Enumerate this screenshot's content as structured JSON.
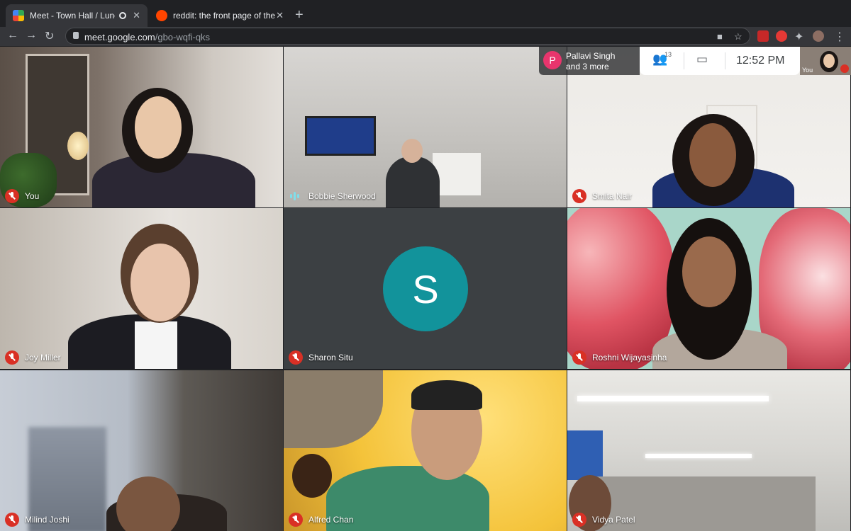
{
  "browser": {
    "tabs": [
      {
        "title": "Meet - Town Hall / Lunch &",
        "active": true
      },
      {
        "title": "reddit: the front page of the int",
        "active": false
      }
    ],
    "url_host": "meet.google.com",
    "url_path": "/gbo-wqfi-qks"
  },
  "meet": {
    "presenting": {
      "avatar_letter": "P",
      "line1": "Pallavi Singh",
      "line2": "and 3 more"
    },
    "participant_count": "13",
    "time": "12:52 PM",
    "self_label": "You"
  },
  "tiles": [
    {
      "name": "You",
      "muted": true
    },
    {
      "name": "Bobbie Sherwood",
      "muted": false,
      "speaking": true
    },
    {
      "name": "Smita Nair",
      "muted": true
    },
    {
      "name": "Joy Miller",
      "muted": true
    },
    {
      "name": "Sharon Situ",
      "muted": true,
      "avatar_letter": "S"
    },
    {
      "name": "Roshni Wijayasinha",
      "muted": true
    },
    {
      "name": "Milind Joshi",
      "muted": true
    },
    {
      "name": "Alfred Chan",
      "muted": true
    },
    {
      "name": "Vidya Patel",
      "muted": true
    }
  ],
  "colors": {
    "mute_red": "#d93025",
    "avatar_teal": "#12939b",
    "presenter_pink": "#e8356d"
  }
}
